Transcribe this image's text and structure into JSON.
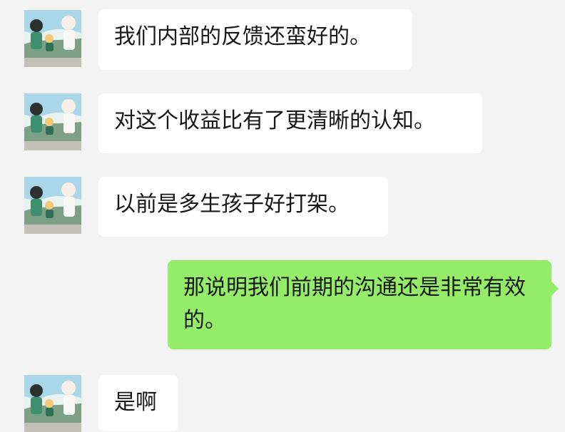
{
  "messages": [
    {
      "side": "received",
      "avatar": "avatar-family-illustration",
      "text": "我们内部的反馈还蛮好的。"
    },
    {
      "side": "received",
      "avatar": "avatar-family-illustration",
      "text": "对这个收益比有了更清晰的认知。"
    },
    {
      "side": "received",
      "avatar": "avatar-family-illustration",
      "text": "以前是多生孩子好打架。"
    },
    {
      "side": "sent",
      "text": "那说明我们前期的沟通还是非常有效的。"
    },
    {
      "side": "received",
      "avatar": "avatar-family-illustration",
      "text": "是啊"
    }
  ],
  "colors": {
    "background": "#f3f3f3",
    "received_bubble": "#ffffff",
    "sent_bubble": "#95ec69",
    "text": "#171717"
  }
}
